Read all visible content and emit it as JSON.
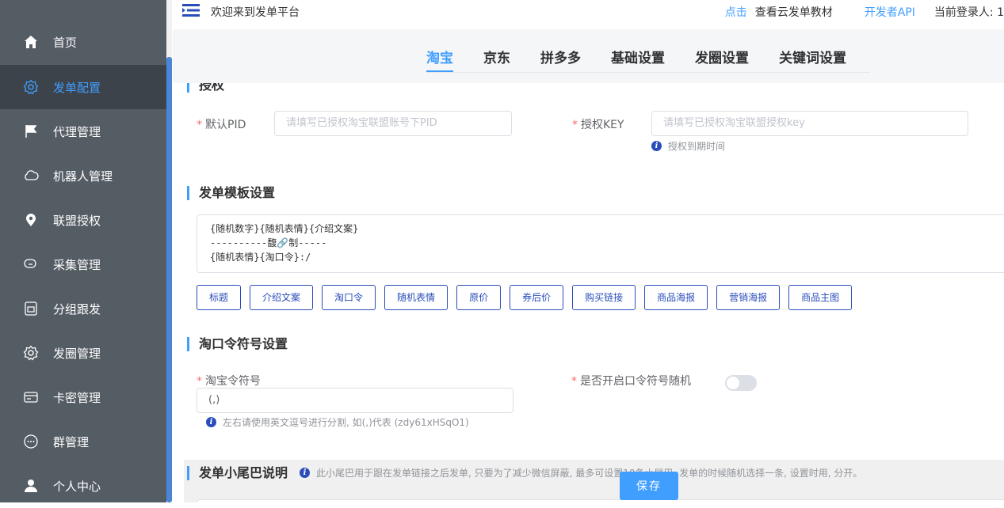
{
  "sidebar": {
    "items": [
      {
        "label": "首页",
        "icon": "home-icon"
      },
      {
        "label": "发单配置",
        "icon": "gear-icon",
        "active": true
      },
      {
        "label": "代理管理",
        "icon": "flag-icon"
      },
      {
        "label": "机器人管理",
        "icon": "cloud-icon"
      },
      {
        "label": "联盟授权",
        "icon": "location-icon"
      },
      {
        "label": "采集管理",
        "icon": "chat-icon"
      },
      {
        "label": "分组跟发",
        "icon": "sim-card-icon"
      },
      {
        "label": "发圈管理",
        "icon": "gear-icon"
      },
      {
        "label": "卡密管理",
        "icon": "card-icon"
      },
      {
        "label": "群管理",
        "icon": "message-icon"
      },
      {
        "label": "个人中心",
        "icon": "user-icon"
      }
    ]
  },
  "header": {
    "welcome": "欢迎来到发单平台",
    "click_label": "点击",
    "tutorial_label": "查看云发单教材",
    "dev_api_label": "开发者API",
    "current_user_label": "当前登录人: 1"
  },
  "tabs": [
    {
      "label": "淘宝",
      "active": true
    },
    {
      "label": "京东"
    },
    {
      "label": "拼多多"
    },
    {
      "label": "基础设置"
    },
    {
      "label": "发圈设置"
    },
    {
      "label": "关键词设置"
    }
  ],
  "auth_section": {
    "title": "授权",
    "pid_label": "默认PID",
    "pid_placeholder": "请填写已授权淘宝联盟账号下PID",
    "key_label": "授权KEY",
    "key_placeholder": "请填写已授权淘宝联盟授权key",
    "expire_hint": "授权到期时间"
  },
  "template_section": {
    "title": "发单模板设置",
    "content": "{随机数字}{随机表情}{介绍文案}\n----------馥🔗制-----\n{随机表情}{淘口令}:/",
    "tags": [
      "标题",
      "介绍文案",
      "淘口令",
      "随机表情",
      "原价",
      "券后价",
      "购买链接",
      "商品海报",
      "营销海报",
      "商品主图"
    ]
  },
  "symbol_section": {
    "title": "淘口令符号设置",
    "symbol_label": "淘宝令符号",
    "symbol_value": "(,)",
    "random_label": "是否开启口令符号随机",
    "random_enabled": false,
    "hint": "左右请使用英文逗号进行分割, 如(,)代表 (zdy61xHSqO1)"
  },
  "tail_section": {
    "title": "发单小尾巴说明",
    "note": "此小尾巴用于跟在发单链接之后发单, 只要为了减少微信屏蔽, 最多可设置10条小尾巴, 发单的时候随机选择一条, 设置时用, 分开。"
  },
  "save_label": "保存"
}
